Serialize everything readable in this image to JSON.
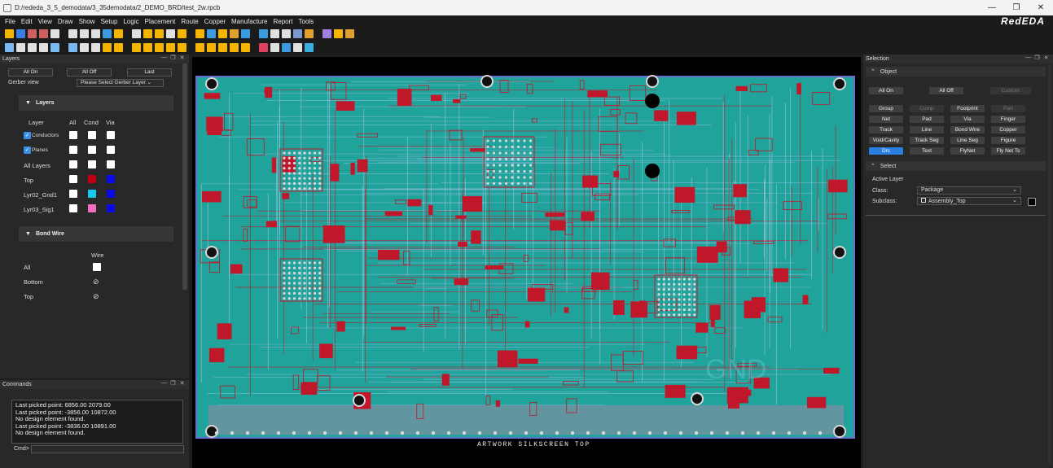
{
  "window": {
    "title": "D:/rededa_3_5_demodata/3_35demodata/2_DEMO_BRD/test_2w.rpcb",
    "min": "—",
    "max": "❐",
    "close": "✕"
  },
  "menu": [
    "File",
    "Edit",
    "View",
    "Draw",
    "Show",
    "Setup",
    "Logic",
    "Placement",
    "Route",
    "Copper",
    "Manufacture",
    "Report",
    "Tools"
  ],
  "brand": "RedEDA",
  "toolbar1": [
    "#f5b400",
    "#3b7de0",
    "#d06060",
    "#d06060",
    "#e0e0e0",
    "#e0e0e0",
    "#e0e0e0",
    "#e0e0e0",
    "#3b9be0",
    "#f5b400",
    "#e0e0e0",
    "#f5b400",
    "#f5b400",
    "#e0e0e0",
    "#f5b400",
    "#f5b400",
    "#3b9be0",
    "#f5b400",
    "#e0a030",
    "#3b9be0",
    "#3b9be0",
    "#e0e0e0",
    "#e0e0e0",
    "#7a9ad0",
    "#e0a030",
    "#a080e0",
    "#f5b400",
    "#e0a030"
  ],
  "toolbar2": [
    "#7ab8f0",
    "#e0e0e0",
    "#e0e0e0",
    "#e0e0e0",
    "#7ab8f0",
    "#7ab8f0",
    "#e0e0e0",
    "#e0e0e0",
    "#f5b400",
    "#f5b400",
    "#f5b400",
    "#f5b400",
    "#f5b400",
    "#f5b400",
    "#f5b400",
    "#f5b400",
    "#f5b400",
    "#f5b400",
    "#f5b400",
    "#f5b400",
    "#e04060",
    "#e0e0e0",
    "#3b9be0",
    "#e0e0e0",
    "#3bb0e0"
  ],
  "layers": {
    "title": "Layers",
    "all_on": "All On",
    "all_off": "All Off",
    "last": "Last",
    "gerber_label": "Gerber view",
    "gerber_select": "Please Select Gerber Layer",
    "section": "Layers",
    "cols": {
      "layer": "Layer",
      "all": "All",
      "cond": "Cond",
      "via": "Via"
    },
    "rows": [
      {
        "name": "Conductors",
        "checked": true,
        "cond": "#ffffff",
        "via": "#ffffff"
      },
      {
        "name": "Planes",
        "checked": true,
        "cond": "#ffffff",
        "via": "#ffffff"
      },
      {
        "name": "All Layers",
        "checked": false,
        "cond": "#ffffff",
        "via": "#ffffff"
      },
      {
        "name": "Top",
        "checked": false,
        "cond": "#c00010",
        "via": "#0a0ae6"
      },
      {
        "name": "Lyr02_Gnd1",
        "checked": false,
        "cond": "#18c8f0",
        "via": "#0a0ae6"
      },
      {
        "name": "Lyr03_Sig1",
        "checked": false,
        "cond": "#f070c0",
        "via": "#0a0ae6"
      }
    ],
    "bond_section": "Bond Wire",
    "wire_col": "Wire",
    "bond_rows": [
      "All",
      "Bottom",
      "Top"
    ]
  },
  "commands": {
    "title": "Commands",
    "lines": [
      "Last picked point: 6856.00 2079.00",
      "Last picked point: -3856.00 10872.00",
      "No design element found.",
      "Last picked point: -3836.00 10891.00",
      "No design element found."
    ],
    "prompt": "Cmd>"
  },
  "selection": {
    "title": "Selection",
    "object_section": "Object",
    "all_on": "All On",
    "all_off": "All Off",
    "custom": "Custom",
    "buttons": [
      {
        "label": "Group",
        "state": "normal"
      },
      {
        "label": "Comp",
        "state": "disabled"
      },
      {
        "label": "Footprint",
        "state": "normal"
      },
      {
        "label": "Part",
        "state": "disabled"
      },
      {
        "label": "Net",
        "state": "normal"
      },
      {
        "label": "Pad",
        "state": "normal"
      },
      {
        "label": "Via",
        "state": "normal"
      },
      {
        "label": "Finger",
        "state": "normal"
      },
      {
        "label": "Track",
        "state": "normal"
      },
      {
        "label": "Line",
        "state": "normal"
      },
      {
        "label": "Bond Wire",
        "state": "normal"
      },
      {
        "label": "Copper",
        "state": "normal"
      },
      {
        "label": "Void/Cavity",
        "state": "normal"
      },
      {
        "label": "Track Seg",
        "state": "normal"
      },
      {
        "label": "Line Seg",
        "state": "normal"
      },
      {
        "label": "Figure",
        "state": "normal"
      },
      {
        "label": "Drc",
        "state": "active"
      },
      {
        "label": "Text",
        "state": "normal"
      },
      {
        "label": "FlyNet",
        "state": "normal"
      },
      {
        "label": "Fly Net Ts",
        "state": "normal"
      }
    ],
    "select_section": "Select",
    "active_layer": "Active Layer",
    "class_label": "Class:",
    "class_value": "Package",
    "subclass_label": "Subclass:",
    "subclass_value": "Assembly_Top"
  },
  "board": {
    "silkscreen_text": "ARTWORK SILKSCREEN TOP",
    "gnd_text": "GND",
    "colors": {
      "board": "#1fa39a",
      "trace": "#c0182a",
      "pad": "#d8d8d8",
      "outline": "#6a6acc"
    }
  }
}
